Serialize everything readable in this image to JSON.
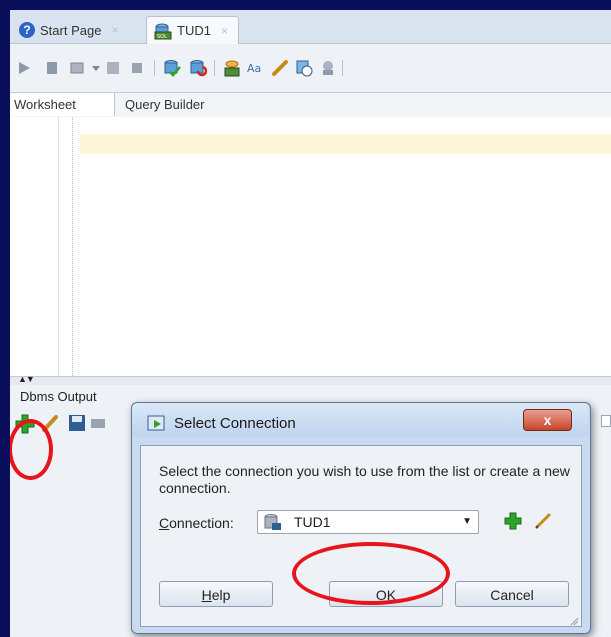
{
  "tabs": [
    {
      "label": "Start Page",
      "icon": "help-icon",
      "close": "×"
    },
    {
      "label": "TUD1",
      "icon": "sql-worksheet-icon",
      "close": "×"
    }
  ],
  "subtabs": {
    "worksheet": "Worksheet",
    "query_builder": "Query Builder"
  },
  "bottom_panel": {
    "tab_label": "Dbms Output"
  },
  "dialog": {
    "title": "Select Connection",
    "close_symbol": "x",
    "message": "Select the connection you wish to use from the list or create a new connection.",
    "connection_label": "Connection:",
    "connection_value": "TUD1",
    "buttons": {
      "help": "Help",
      "ok": "OK",
      "cancel": "Cancel"
    }
  },
  "splitter_symbol": "▲▼",
  "colors": {
    "highlight": "#e8141b",
    "add_green": "#2aa52a",
    "desktop_bg": "#0a0f5c"
  }
}
